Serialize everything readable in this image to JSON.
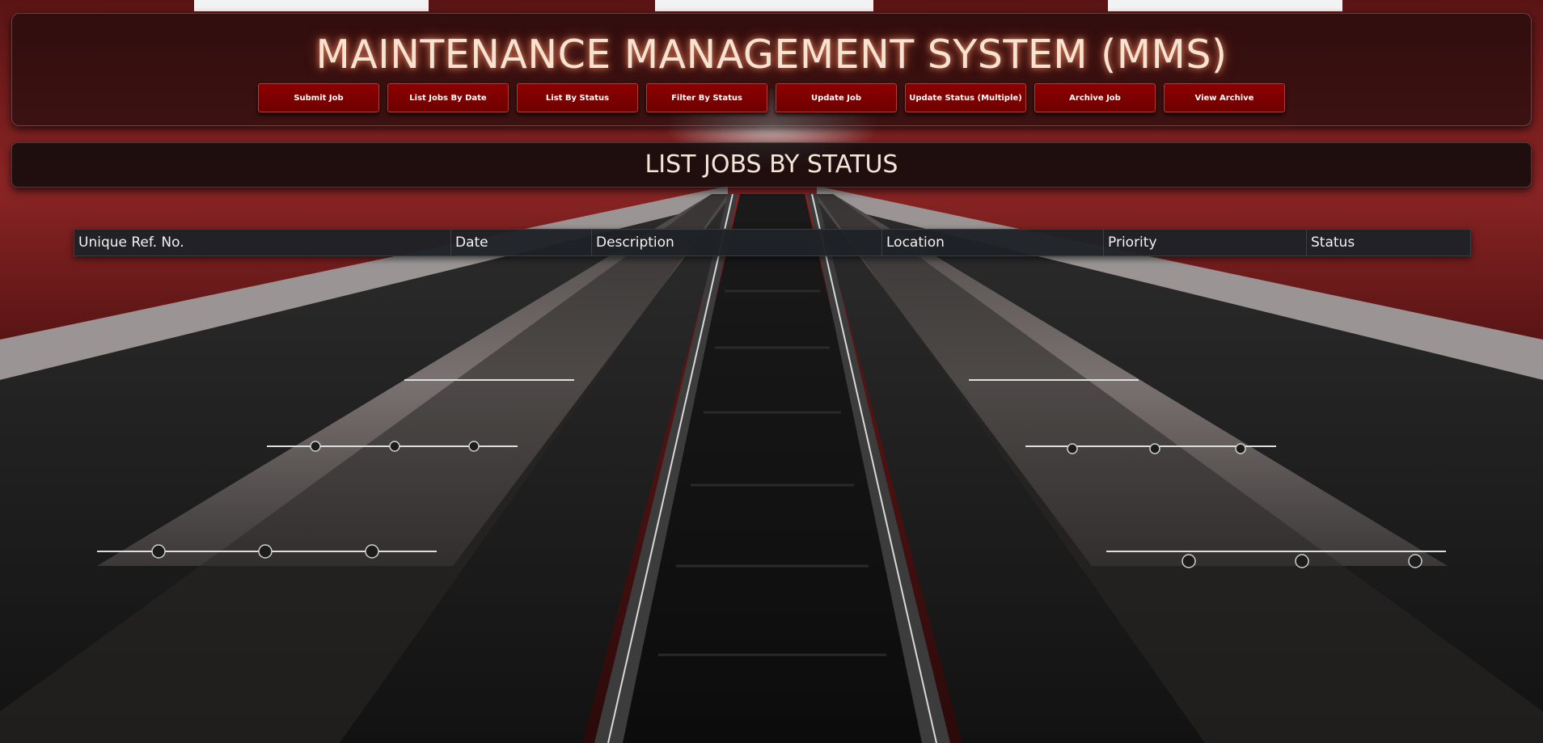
{
  "app": {
    "title": "MAINTENANCE MANAGEMENT SYSTEM (MMS)"
  },
  "nav": {
    "items": [
      {
        "label": "Submit Job"
      },
      {
        "label": "List Jobs By Date"
      },
      {
        "label": "List By Status"
      },
      {
        "label": "Filter By Status"
      },
      {
        "label": "Update Job"
      },
      {
        "label": "Update Status (Multiple)"
      },
      {
        "label": "Archive Job"
      },
      {
        "label": "View Archive"
      }
    ]
  },
  "section": {
    "title": "LIST JOBS BY STATUS"
  },
  "table": {
    "columns": [
      "Unique Ref. No.",
      "Date",
      "Description",
      "Location",
      "Priority",
      "Status"
    ],
    "rows": []
  },
  "colors": {
    "button_red": "#8d0000",
    "title_glow": "#ff9670",
    "table_header": "#1e2125"
  }
}
